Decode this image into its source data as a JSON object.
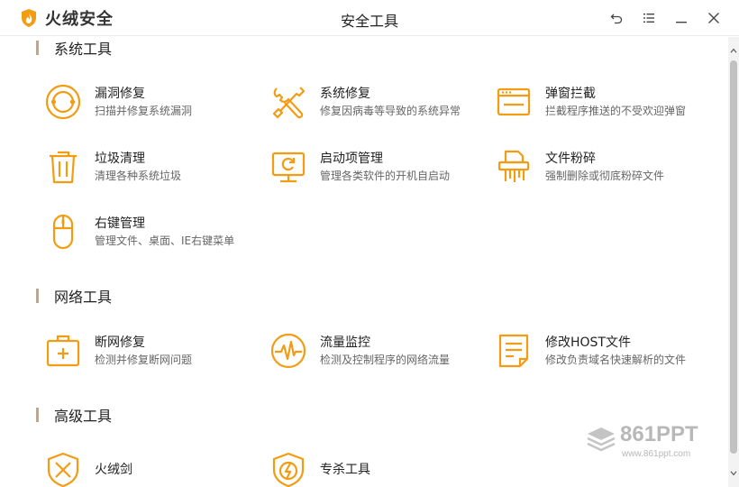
{
  "app": {
    "brand": "火绒安全",
    "window_title": "安全工具"
  },
  "colors": {
    "accent": "#f39c12",
    "section_bar": "#b9a894"
  },
  "icons": {
    "logo": "flame-shield-icon",
    "back": "back-arrow-icon",
    "menu": "menu-icon",
    "minimize": "minimize-icon",
    "close": "close-icon"
  },
  "sections": [
    {
      "title": "系统工具"
    },
    {
      "title": "网络工具"
    },
    {
      "title": "高级工具"
    }
  ],
  "tools": {
    "vuln_fix": {
      "name": "漏洞修复",
      "desc": "扫描并修复系统漏洞",
      "icon": "vulnerability-fix-icon"
    },
    "sys_repair": {
      "name": "系统修复",
      "desc": "修复因病毒等导致的系统异常",
      "icon": "wrench-screwdriver-icon"
    },
    "popup_block": {
      "name": "弹窗拦截",
      "desc": "拦截程序推送的不受欢迎弹窗",
      "icon": "popup-window-icon"
    },
    "junk_clean": {
      "name": "垃圾清理",
      "desc": "清理各种系统垃圾",
      "icon": "trash-can-icon"
    },
    "startup_mgr": {
      "name": "启动项管理",
      "desc": "管理各类软件的开机自启动",
      "icon": "monitor-refresh-icon"
    },
    "file_shred": {
      "name": "文件粉碎",
      "desc": "强制删除或彻底粉碎文件",
      "icon": "file-shredder-icon"
    },
    "ctx_menu": {
      "name": "右键管理",
      "desc": "管理文件、桌面、IE右键菜单",
      "icon": "mouse-icon"
    },
    "net_fix": {
      "name": "断网修复",
      "desc": "检测并修复断网问题",
      "icon": "first-aid-kit-icon"
    },
    "traffic_mon": {
      "name": "流量监控",
      "desc": "检测及控制程序的网络流量",
      "icon": "pulse-monitor-icon"
    },
    "host_edit": {
      "name": "修改HOST文件",
      "desc": "修改负责域名快速解析的文件",
      "icon": "document-edit-icon"
    },
    "sword": {
      "name": "火绒剑",
      "icon": "sword-shield-icon"
    },
    "special_kill": {
      "name": "专杀工具",
      "icon": "lightning-shield-icon"
    }
  },
  "watermark": {
    "main": "861PPT",
    "sub": "www.861ppt.com"
  }
}
